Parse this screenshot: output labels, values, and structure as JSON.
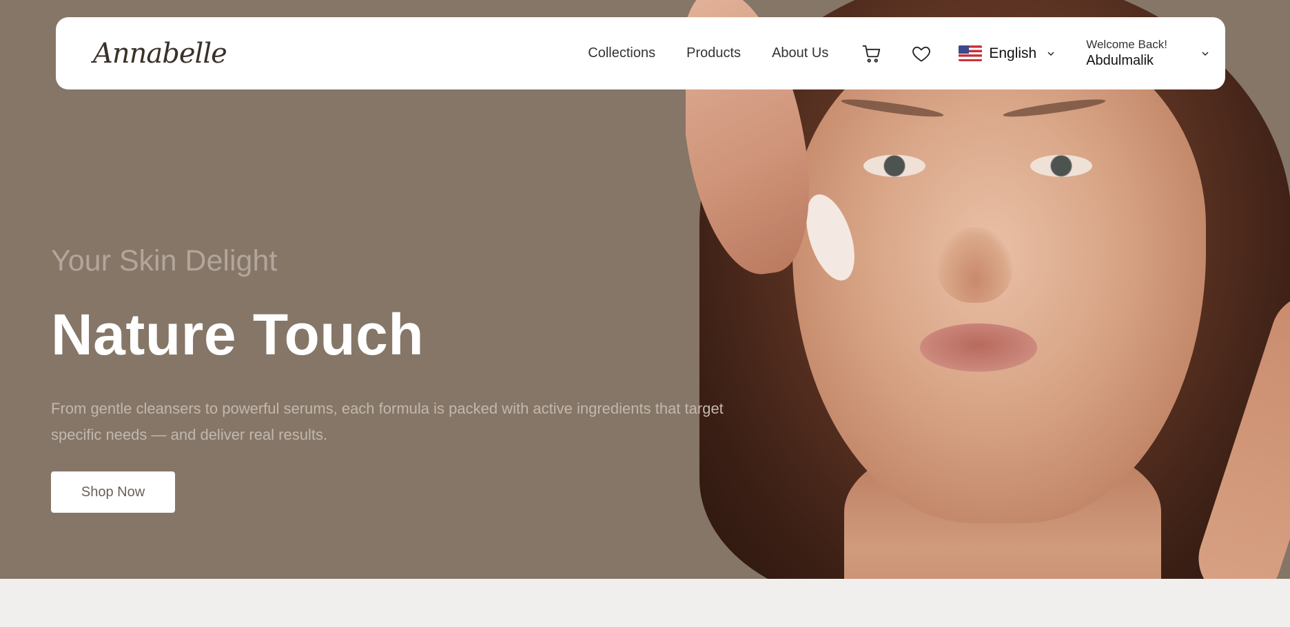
{
  "brand": {
    "logo_text": "Annabelle"
  },
  "nav": {
    "links": [
      "Collections",
      "Products",
      "About Us"
    ],
    "cart_icon": "cart-icon",
    "wishlist_icon": "heart-icon",
    "language": {
      "flag": "us-flag-icon",
      "label": "English"
    },
    "user": {
      "greeting": "Welcome Back!",
      "name": "Abdulmalik"
    }
  },
  "hero": {
    "subtitle": "Your Skin Delight",
    "headline": "Nature Touch",
    "description": "From gentle cleansers to powerful serums, each formula is packed with active ingredients that target specific needs — and deliver real results.",
    "cta_label": "Shop Now",
    "image": "woman-applying-face-cream-photo"
  },
  "colors": {
    "hero_bg": "#857667",
    "navbar_bg": "#ffffff",
    "page_bg": "#f1efed",
    "headline": "#ffffff",
    "subtitle": "#b3a59b"
  }
}
